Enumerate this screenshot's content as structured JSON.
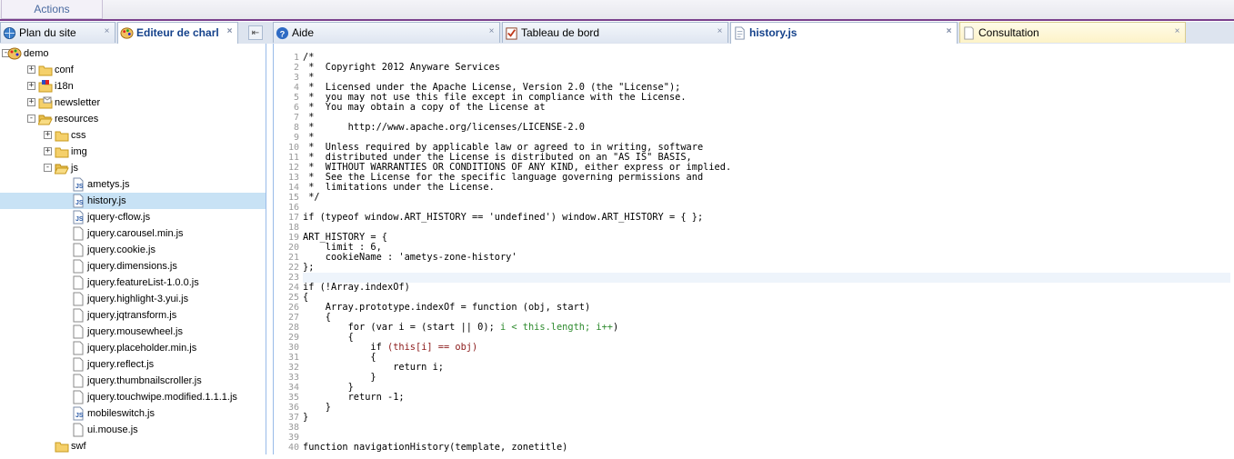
{
  "topbar": {
    "actions_label": "Actions"
  },
  "tabs": [
    {
      "label": "Plan du site",
      "icon": "sitemap-icon"
    },
    {
      "label": "Editeur de charl",
      "icon": "palette-icon"
    },
    {
      "label": "Aide",
      "icon": "help-icon"
    },
    {
      "label": "Tableau de bord",
      "icon": "dashboard-icon"
    },
    {
      "label": "history.js",
      "icon": "file-js-icon"
    },
    {
      "label": "Consultation",
      "icon": "page-icon"
    }
  ],
  "tree": [
    {
      "label": "demo",
      "icon": "palette-icon",
      "expander": "-",
      "depth": 0
    },
    {
      "label": "conf",
      "icon": "folder-icon",
      "expander": "+",
      "depth": 1
    },
    {
      "label": "i18n",
      "icon": "flag-icon",
      "expander": "+",
      "depth": 1
    },
    {
      "label": "newsletter",
      "icon": "newsletter-icon",
      "expander": "+",
      "depth": 1
    },
    {
      "label": "resources",
      "icon": "folder-open-icon",
      "expander": "-",
      "depth": 1
    },
    {
      "label": "css",
      "icon": "folder-icon",
      "expander": "+",
      "depth": 2
    },
    {
      "label": "img",
      "icon": "folder-icon",
      "expander": "+",
      "depth": 2
    },
    {
      "label": "js",
      "icon": "folder-open-icon",
      "expander": "-",
      "depth": 2
    },
    {
      "label": "ametys.js",
      "icon": "js-file-icon",
      "expander": "",
      "depth": 3
    },
    {
      "label": "history.js",
      "icon": "js-file-icon",
      "expander": "",
      "depth": 3,
      "selected": true
    },
    {
      "label": "jquery-cflow.js",
      "icon": "js-file-icon",
      "expander": "",
      "depth": 3
    },
    {
      "label": "jquery.carousel.min.js",
      "icon": "file-icon",
      "expander": "",
      "depth": 3
    },
    {
      "label": "jquery.cookie.js",
      "icon": "file-icon",
      "expander": "",
      "depth": 3
    },
    {
      "label": "jquery.dimensions.js",
      "icon": "file-icon",
      "expander": "",
      "depth": 3
    },
    {
      "label": "jquery.featureList-1.0.0.js",
      "icon": "file-icon",
      "expander": "",
      "depth": 3
    },
    {
      "label": "jquery.highlight-3.yui.js",
      "icon": "file-icon",
      "expander": "",
      "depth": 3
    },
    {
      "label": "jquery.jqtransform.js",
      "icon": "file-icon",
      "expander": "",
      "depth": 3
    },
    {
      "label": "jquery.mousewheel.js",
      "icon": "file-icon",
      "expander": "",
      "depth": 3
    },
    {
      "label": "jquery.placeholder.min.js",
      "icon": "file-icon",
      "expander": "",
      "depth": 3
    },
    {
      "label": "jquery.reflect.js",
      "icon": "file-icon",
      "expander": "",
      "depth": 3
    },
    {
      "label": "jquery.thumbnailscroller.js",
      "icon": "file-icon",
      "expander": "",
      "depth": 3
    },
    {
      "label": "jquery.touchwipe.modified.1.1.1.js",
      "icon": "file-icon",
      "expander": "",
      "depth": 3
    },
    {
      "label": "mobileswitch.js",
      "icon": "js-file-icon",
      "expander": "",
      "depth": 3
    },
    {
      "label": "ui.mouse.js",
      "icon": "file-icon",
      "expander": "",
      "depth": 3
    },
    {
      "label": "swf",
      "icon": "folder-icon",
      "expander": "",
      "depth": 2
    }
  ],
  "editor": {
    "lines": [
      "/*",
      " *  Copyright 2012 Anyware Services",
      " *",
      " *  Licensed under the Apache License, Version 2.0 (the \"License\");",
      " *  you may not use this file except in compliance with the License.",
      " *  You may obtain a copy of the License at",
      " *",
      " *      http://www.apache.org/licenses/LICENSE-2.0",
      " *",
      " *  Unless required by applicable law or agreed to in writing, software",
      " *  distributed under the License is distributed on an \"AS IS\" BASIS,",
      " *  WITHOUT WARRANTIES OR CONDITIONS OF ANY KIND, either express or implied.",
      " *  See the License for the specific language governing permissions and",
      " *  limitations under the License.",
      " */",
      "",
      "if (typeof window.ART_HISTORY == 'undefined') window.ART_HISTORY = { };",
      "",
      "ART_HISTORY = {",
      "    limit : 6,",
      "    cookieName : 'ametys-zone-history'",
      "};",
      "",
      "if (!Array.indexOf)",
      "{",
      "    Array.prototype.indexOf = function (obj, start)",
      "    {",
      "        for (var i = (start || 0); i < this.length; i++)",
      "        {",
      "            if (this[i] == obj)",
      "            {",
      "                return i;",
      "            }",
      "        }",
      "        return -1;",
      "    }",
      "}",
      "",
      "",
      "function navigationHistory(template, zonetitle)"
    ]
  }
}
